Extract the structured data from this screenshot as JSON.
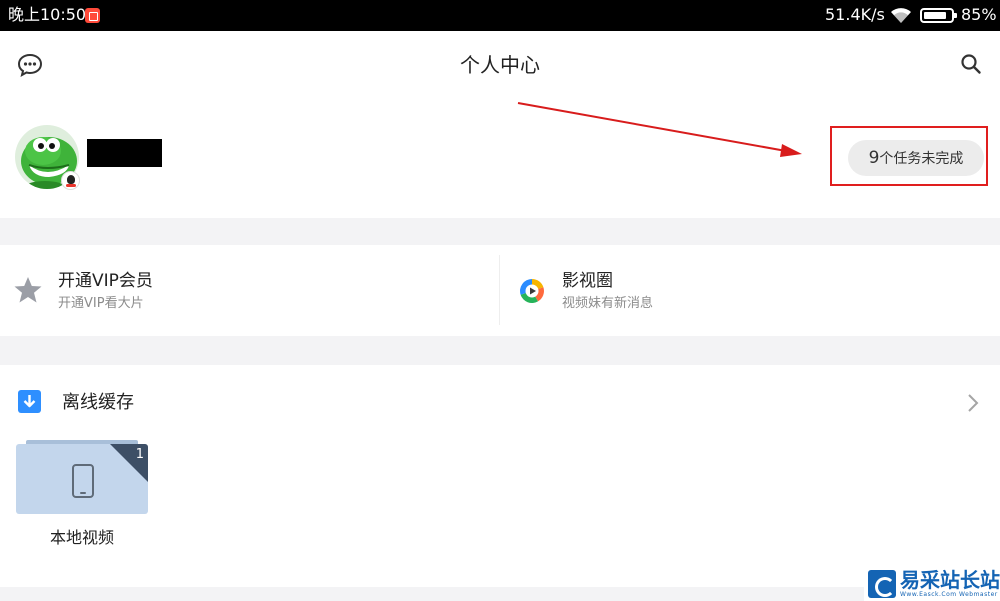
{
  "status_bar": {
    "time": "晚上10:50",
    "net_speed": "51.4K/s",
    "battery": "85%",
    "battery_level": 0.85,
    "icons": [
      "notification-app-icon",
      "wifi-icon",
      "battery-icon"
    ]
  },
  "header": {
    "title": "个人中心",
    "left_icon": "message-bubble-icon",
    "right_icon": "search-icon"
  },
  "profile": {
    "username": "",
    "tasks_count": "9",
    "tasks_label": "个任务未完成",
    "avatar_icon": "dinosaur-avatar",
    "badge_icon": "qq-penguin-icon",
    "annotation_color": "#e01e1e"
  },
  "quick_links": [
    {
      "title": "开通VIP会员",
      "subtitle": "开通VIP看大片",
      "icon": "star-icon"
    },
    {
      "title": "影视圈",
      "subtitle": "视频妹有新消息",
      "icon": "colorful-circle-icon"
    }
  ],
  "offline": {
    "title": "离线缓存",
    "icon": "download-icon",
    "accent_color": "#2e8fff",
    "folders": [
      {
        "label": "本地视频",
        "count": "1",
        "icon": "phone-icon"
      }
    ]
  },
  "watermark": {
    "text": "易采站长站",
    "sub": "Www.Easck.Com Webmaster"
  }
}
